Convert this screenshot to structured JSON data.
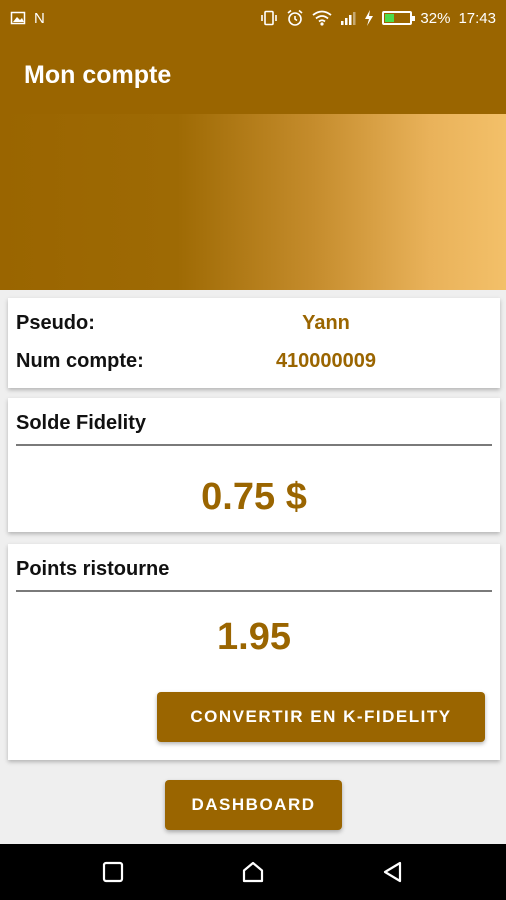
{
  "status_bar": {
    "left_icons": [
      "image-icon",
      "n-icon"
    ],
    "n_label": "N",
    "battery_percent": "32%",
    "battery_level": 0.32,
    "time": "17:43"
  },
  "app_bar": {
    "title": "Mon compte"
  },
  "account": {
    "pseudo_label": "Pseudo:",
    "pseudo_value": "Yann",
    "num_label": "Num compte:",
    "num_value": "410000009"
  },
  "solde": {
    "title": "Solde Fidelity",
    "value": "0.75 $"
  },
  "points": {
    "title": "Points ristourne",
    "value": "1.95",
    "convert_label": "CONVERTIR EN K-FIDELITY"
  },
  "dashboard": {
    "label": "DASHBOARD"
  },
  "colors": {
    "primary": "#9a6500",
    "gradient_end": "#f3c069",
    "background": "#efefef"
  }
}
